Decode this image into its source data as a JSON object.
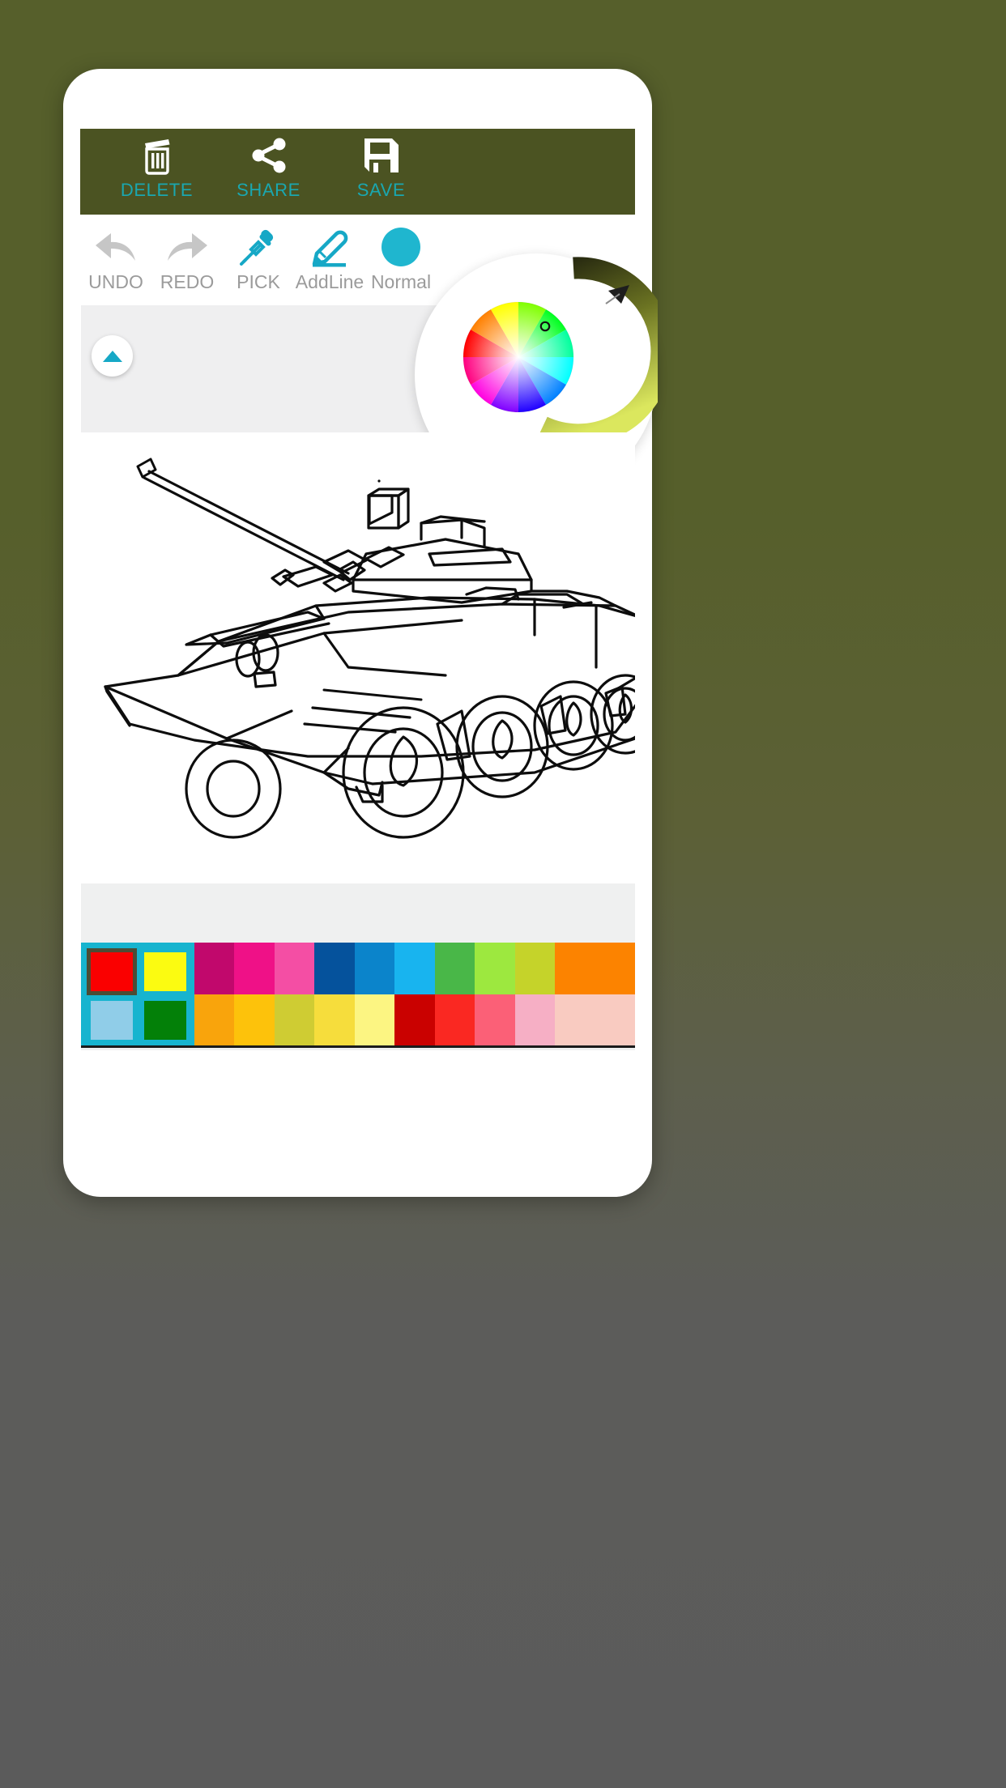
{
  "app": {
    "name": "coloring-app",
    "accent_teal": "#1aa7b0",
    "accent_cyan": "#16a8c6",
    "actionbar_bg": "#4b5322",
    "page_bg_top": "#565f2b",
    "page_bg_bottom": "#5b5b5b"
  },
  "action_bar": {
    "items": [
      {
        "label": "DELETE",
        "icon": "trash-icon"
      },
      {
        "label": "SHARE",
        "icon": "share-icon"
      },
      {
        "label": "SAVE",
        "icon": "floppy-save-icon"
      }
    ]
  },
  "toolbar": {
    "items": [
      {
        "label": "UNDO",
        "icon": "undo-arrow-icon",
        "state": "disabled",
        "color": "#c6c6c6"
      },
      {
        "label": "REDO",
        "icon": "redo-arrow-icon",
        "state": "disabled",
        "color": "#c6c6c6"
      },
      {
        "label": "PICK",
        "icon": "eyedropper-icon",
        "state": "enabled",
        "color": "#16a8c6"
      },
      {
        "label": "AddLine",
        "icon": "pencil-line-icon",
        "state": "enabled",
        "color": "#16a8c6"
      },
      {
        "label": "Normal",
        "icon": "brush-mode-circle-icon",
        "state": "enabled",
        "color": "#1fb6cf"
      }
    ]
  },
  "panel": {
    "collapse_button": {
      "icon": "triangle-up-icon",
      "name": "collapse-panel-button"
    },
    "strip_bg": "#efeff0"
  },
  "color_picker": {
    "name": "hsv-color-wheel",
    "selector_marker": "wheel-selector-ring",
    "brightness_arc": {
      "name": "brightness-arc",
      "start_color": "#2b2d18",
      "end_color": "#d7e35a",
      "handle": "arc-handle-triangle"
    },
    "selected_color": "#8ab52a"
  },
  "canvas": {
    "name": "coloring-canvas",
    "artwork": "armored-vehicle-tank-lineart",
    "background": "#ffffff"
  },
  "palette": {
    "recent_label": "recent-colors",
    "recent": [
      {
        "color": "#fa0000",
        "selected": true
      },
      {
        "color": "#fbfb11",
        "selected": false
      },
      {
        "color": "#90cde8",
        "selected": false
      },
      {
        "color": "#038008",
        "selected": false
      }
    ],
    "recent_bg": "#17b4cf",
    "swatches_row1": [
      "#c1086c",
      "#ef1187",
      "#f44ea4",
      "#05529c",
      "#0b84cb",
      "#18b4ef",
      "#49b748",
      "#9de83f",
      "#c5d32a",
      "#fc8300"
    ],
    "swatches_row2": [
      "#f9a40c",
      "#fdc20b",
      "#cfcc33",
      "#f6dd3c",
      "#fcf582",
      "#ca0100",
      "#fa2822",
      "#fb6077",
      "#f6afc5",
      "#f9cbc1"
    ]
  }
}
